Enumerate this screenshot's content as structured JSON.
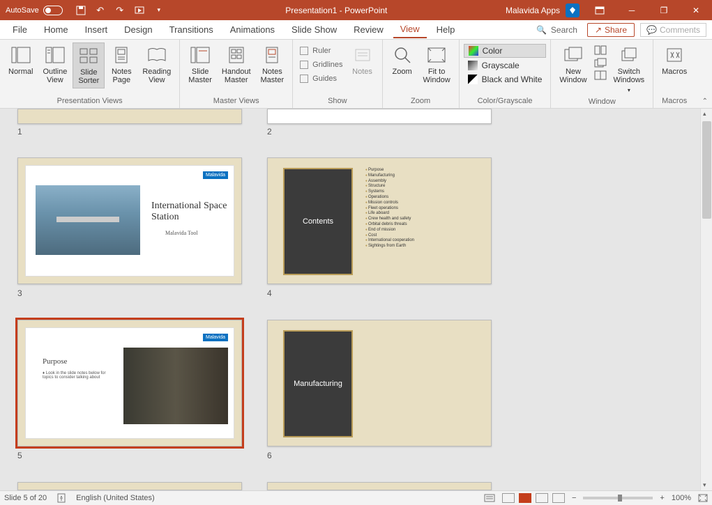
{
  "titlebar": {
    "autosave": "AutoSave",
    "title": "Presentation1 - PowerPoint",
    "user": "Malavida Apps"
  },
  "tabs": {
    "file": "File",
    "home": "Home",
    "insert": "Insert",
    "design": "Design",
    "transitions": "Transitions",
    "animations": "Animations",
    "slideshow": "Slide Show",
    "review": "Review",
    "view": "View",
    "help": "Help",
    "search": "Search",
    "share": "Share",
    "comments": "Comments"
  },
  "ribbon": {
    "presentation_views": {
      "label": "Presentation Views",
      "normal": "Normal",
      "outline": "Outline\nView",
      "sorter": "Slide\nSorter",
      "notes": "Notes\nPage",
      "reading": "Reading\nView"
    },
    "master_views": {
      "label": "Master Views",
      "slide": "Slide\nMaster",
      "handout": "Handout\nMaster",
      "notes": "Notes\nMaster"
    },
    "show": {
      "label": "Show",
      "ruler": "Ruler",
      "gridlines": "Gridlines",
      "guides": "Guides",
      "notes": "Notes"
    },
    "zoom": {
      "label": "Zoom",
      "zoom": "Zoom",
      "fit": "Fit to\nWindow"
    },
    "color": {
      "label": "Color/Grayscale",
      "color": "Color",
      "grayscale": "Grayscale",
      "bw": "Black and White"
    },
    "window": {
      "label": "Window",
      "new": "New\nWindow",
      "switch": "Switch\nWindows"
    },
    "macros": {
      "label": "Macros",
      "macros": "Macros"
    }
  },
  "slides": {
    "s1_num": "1",
    "s2_num": "2",
    "s3_num": "3",
    "s4_num": "4",
    "s5_num": "5",
    "s6_num": "6",
    "s3": {
      "title": "International Space Station",
      "subtitle": "Malavida Tool",
      "logo": "Malavida"
    },
    "s4": {
      "title": "Contents",
      "items": [
        "Purpose",
        "Manufacturing",
        "Assembly",
        "Structure",
        "Systems",
        "Operations",
        "Mission controls",
        "Fleet operations",
        "Life aboard",
        "Crew health and safety",
        "Orbital debris threats",
        "End of mission",
        "Cost",
        "International cooperation",
        "Sightings from Earth"
      ]
    },
    "s5": {
      "title": "Purpose",
      "bullet": "Look in the slide notes below for topics to consider talking about",
      "logo": "Malavida"
    },
    "s6": {
      "title": "Manufacturing"
    }
  },
  "status": {
    "slide": "Slide 5 of 20",
    "lang": "English (United States)",
    "zoom": "100%"
  }
}
